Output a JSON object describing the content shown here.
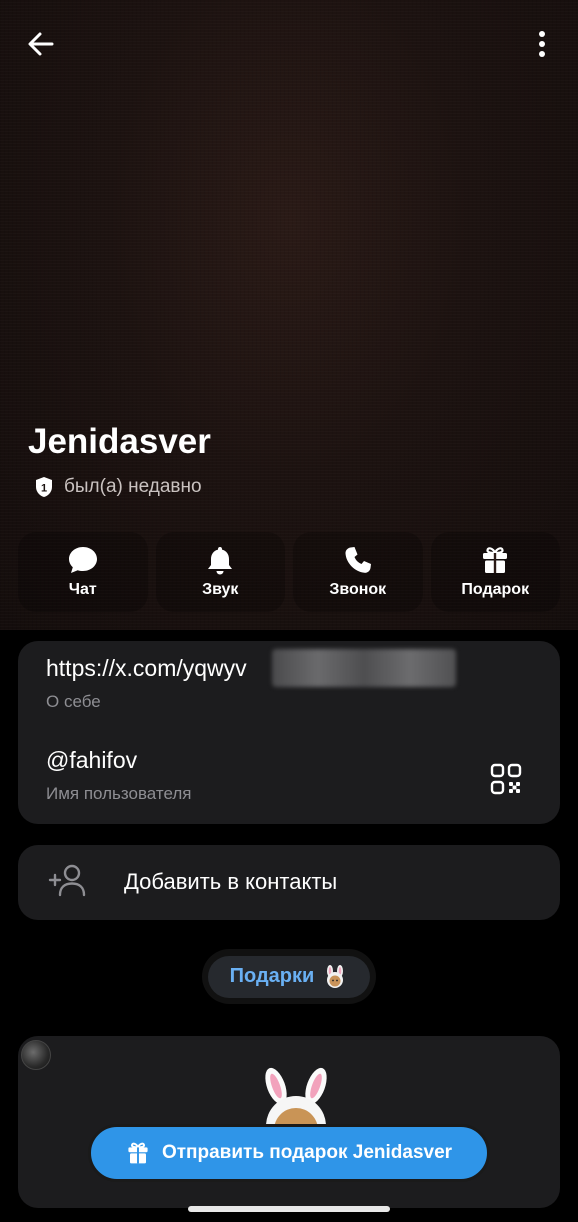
{
  "profile": {
    "name": "Jenidasver",
    "status": "был(а) недавно"
  },
  "actions": [
    {
      "label": "Чат",
      "icon": "chat-bubble-icon"
    },
    {
      "label": "Звук",
      "icon": "bell-icon"
    },
    {
      "label": "Звонок",
      "icon": "phone-icon"
    },
    {
      "label": "Подарок",
      "icon": "gift-icon"
    }
  ],
  "info": {
    "bio_value": "https://x.com/yqwyv",
    "bio_label": "О себе",
    "username_value": "@fahifov",
    "username_label": "Имя пользователя"
  },
  "contact": {
    "add_label": "Добавить в контакты"
  },
  "gifts": {
    "pill_label": "Подарки",
    "send_label": "Отправить подарок Jenidasver"
  },
  "colors": {
    "accent": "#2f95e8",
    "link_accent": "#6ab0f3",
    "card_bg": "#1c1c1e",
    "muted_text": "#8e8e93"
  }
}
